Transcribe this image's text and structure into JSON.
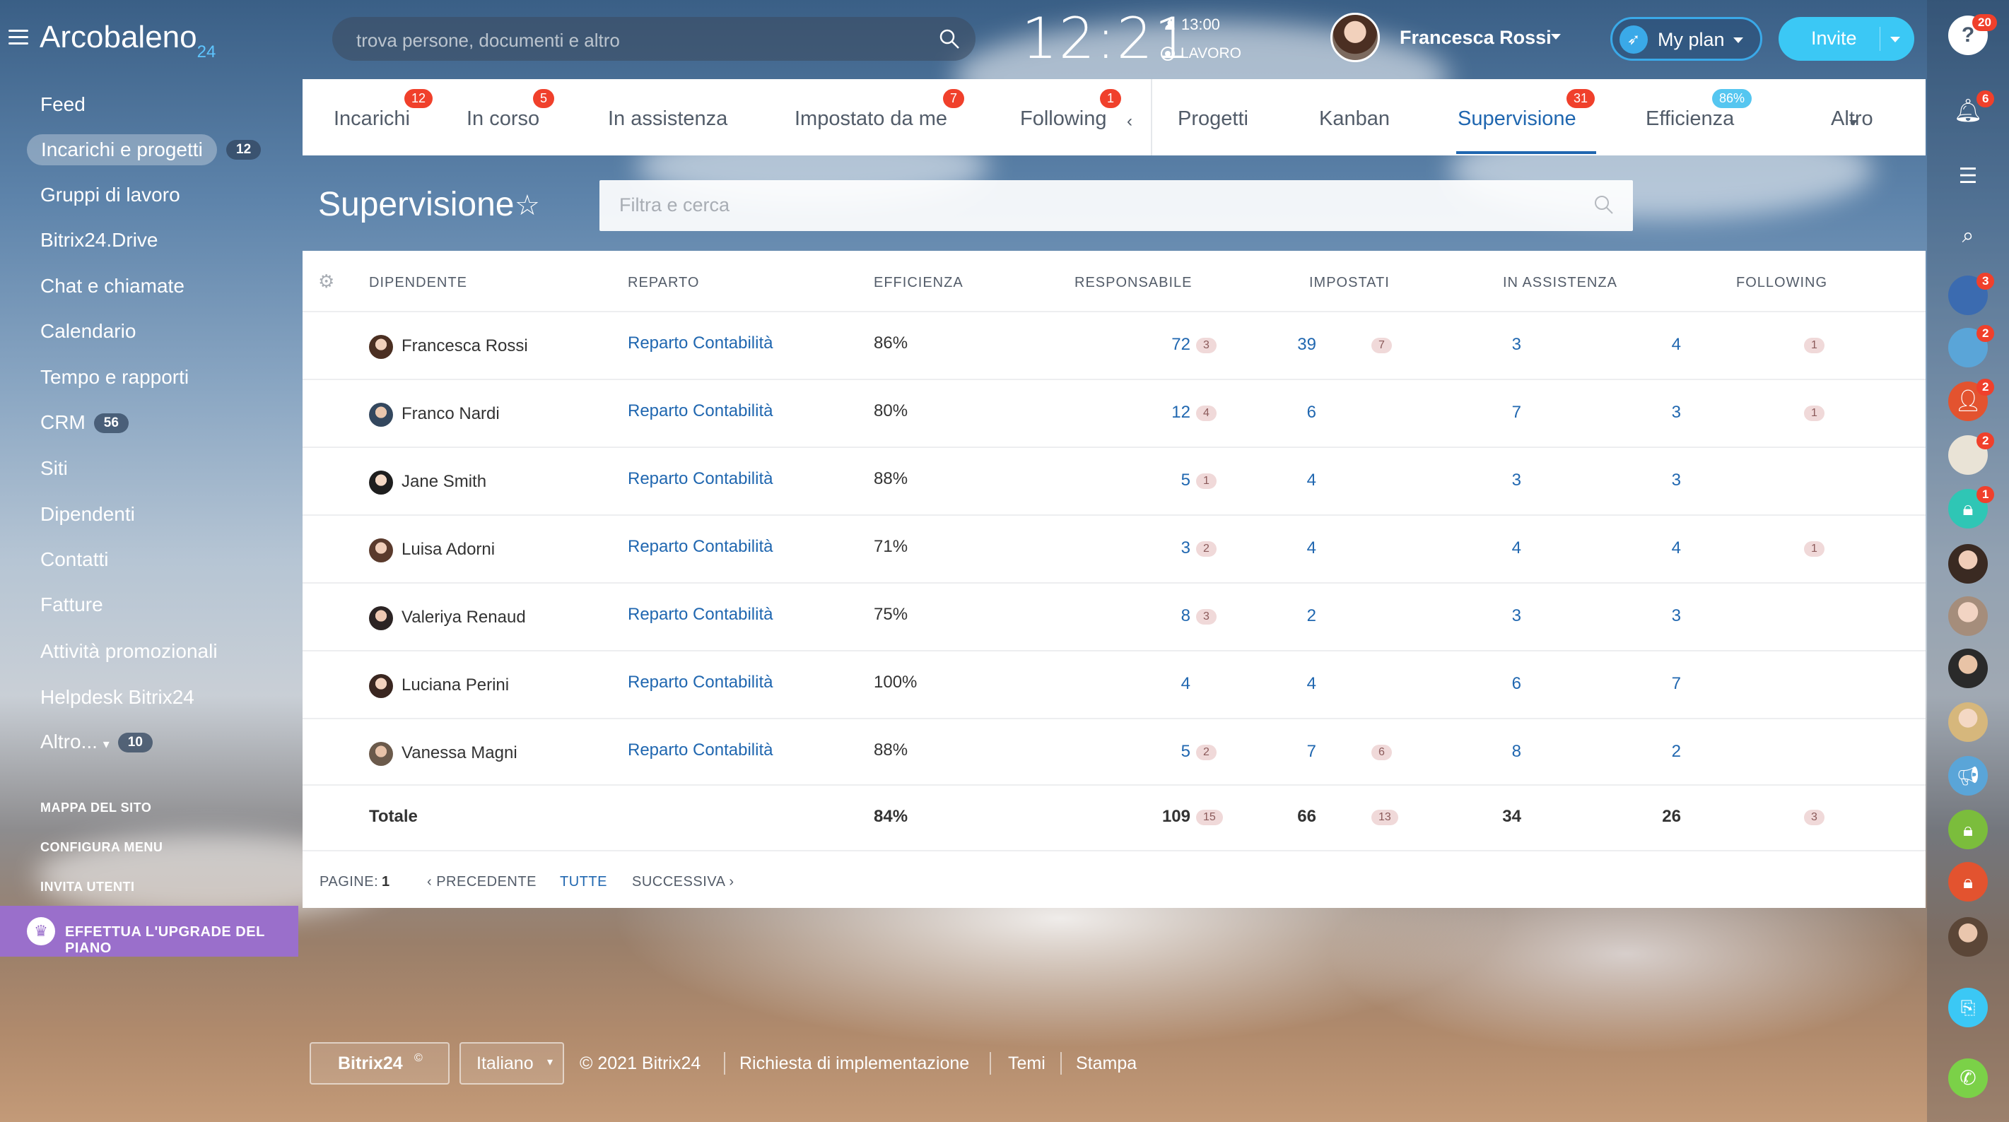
{
  "app": {
    "brand": "Arcobaleno",
    "brand_num": "24"
  },
  "search": {
    "placeholder": "trova persone, documenti e altro"
  },
  "clock": {
    "time": "12:21",
    "alarm": "13:00",
    "status": "LAVORO"
  },
  "user": {
    "name": "Francesca Rossi"
  },
  "header_buttons": {
    "myplan": "My plan",
    "invite": "Invite"
  },
  "sidebar": {
    "items": [
      {
        "label": "Feed"
      },
      {
        "label": "Incarichi e progetti",
        "count": "12"
      },
      {
        "label": "Gruppi di lavoro"
      },
      {
        "label": "Bitrix24.Drive"
      },
      {
        "label": "Chat e chiamate"
      },
      {
        "label": "Calendario"
      },
      {
        "label": "Tempo e rapporti"
      },
      {
        "label": "CRM",
        "count": "56"
      },
      {
        "label": "Siti"
      },
      {
        "label": "Dipendenti"
      },
      {
        "label": "Contatti"
      },
      {
        "label": "Fatture"
      },
      {
        "label": "Attività promozionali"
      },
      {
        "label": "Helpdesk Bitrix24"
      },
      {
        "label": "Altro...",
        "count": "10"
      }
    ],
    "links": [
      "MAPPA DEL SITO",
      "CONFIGURA MENU",
      "INVITA UTENTI"
    ],
    "upgrade": "EFFETTUA L'UPGRADE DEL PIANO"
  },
  "tabs": [
    {
      "label": "Incarichi",
      "badge": "12"
    },
    {
      "label": "In corso",
      "badge": "5"
    },
    {
      "label": "In assistenza"
    },
    {
      "label": "Impostato da me",
      "badge": "7"
    },
    {
      "label": "Following",
      "badge": "1"
    },
    {
      "label": "Progetti"
    },
    {
      "label": "Kanban"
    },
    {
      "label": "Supervisione",
      "badge": "31",
      "active": true
    },
    {
      "label": "Efficienza",
      "badge": "86%"
    },
    {
      "label": "Altro"
    }
  ],
  "page": {
    "title": "Supervisione",
    "filter_placeholder": "Filtra e cerca"
  },
  "table": {
    "columns": [
      "DIPENDENTE",
      "REPARTO",
      "EFFICIENZA",
      "RESPONSABILE",
      "IMPOSTATI",
      "IN ASSISTENZA",
      "FOLLOWING"
    ],
    "rows": [
      {
        "name": "Francesca Rossi",
        "dept": "Reparto Contabilità",
        "eff": "86%",
        "resp": "72",
        "resp_b": "3",
        "imp": "39",
        "imp_b": "7",
        "ass": "3",
        "fol": "4",
        "fol_b": "1"
      },
      {
        "name": "Franco Nardi",
        "dept": "Reparto Contabilità",
        "eff": "80%",
        "resp": "12",
        "resp_b": "4",
        "imp": "6",
        "imp_b": "",
        "ass": "7",
        "fol": "3",
        "fol_b": "1"
      },
      {
        "name": "Jane Smith",
        "dept": "Reparto Contabilità",
        "eff": "88%",
        "resp": "5",
        "resp_b": "1",
        "imp": "4",
        "imp_b": "",
        "ass": "3",
        "fol": "3",
        "fol_b": ""
      },
      {
        "name": "Luisa Adorni",
        "dept": "Reparto Contabilità",
        "eff": "71%",
        "resp": "3",
        "resp_b": "2",
        "imp": "4",
        "imp_b": "",
        "ass": "4",
        "fol": "4",
        "fol_b": "1"
      },
      {
        "name": "Valeriya Renaud",
        "dept": "Reparto Contabilità",
        "eff": "75%",
        "resp": "8",
        "resp_b": "3",
        "imp": "2",
        "imp_b": "",
        "ass": "3",
        "fol": "3",
        "fol_b": ""
      },
      {
        "name": "Luciana Perini",
        "dept": "Reparto Contabilità",
        "eff": "100%",
        "resp": "4",
        "resp_b": "",
        "imp": "4",
        "imp_b": "",
        "ass": "6",
        "fol": "7",
        "fol_b": ""
      },
      {
        "name": "Vanessa Magni",
        "dept": "Reparto Contabilità",
        "eff": "88%",
        "resp": "5",
        "resp_b": "2",
        "imp": "7",
        "imp_b": "6",
        "ass": "8",
        "fol": "2",
        "fol_b": ""
      }
    ],
    "total": {
      "label": "Totale",
      "eff": "84%",
      "resp": "109",
      "resp_b": "15",
      "imp": "66",
      "imp_b": "13",
      "ass": "34",
      "fol": "26",
      "fol_b": "3"
    }
  },
  "pager": {
    "label": "PAGINE:",
    "page": "1",
    "prev": "PRECEDENTE",
    "all": "TUTTE",
    "next": "SUCCESSIVA"
  },
  "right_panel": {
    "help_badge": "20",
    "bell_badge": "6",
    "chat_badges": [
      "3",
      "2",
      "2",
      "2",
      "1"
    ]
  },
  "footer": {
    "logo": "Bitrix24",
    "language": "Italiano",
    "copyright": "© 2021 Bitrix24",
    "links": [
      "Richiesta di implementazione",
      "Temi",
      "Stampa"
    ]
  },
  "colors": {
    "accent": "#2067b0",
    "badge_red": "#f0402b",
    "upgrade": "#9a6fcb",
    "invite": "#3bc8f5"
  }
}
